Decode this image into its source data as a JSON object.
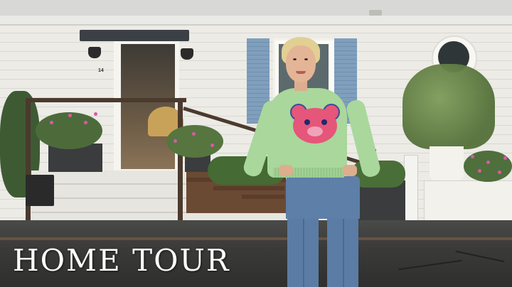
{
  "overlay": {
    "title": "HOME TOUR"
  },
  "scene": {
    "house_number": "14",
    "colors": {
      "siding": "#ecebe6",
      "shutters": "#7f9fbd",
      "deck_rail": "#4b3a2e",
      "sweater": "#a9d79c",
      "bear": "#e5567a",
      "jeans": "#5d7fa8",
      "title_text": "#ffffff"
    },
    "icons": [
      "wall-lamp-icon",
      "teddy-bear-graphic"
    ]
  }
}
